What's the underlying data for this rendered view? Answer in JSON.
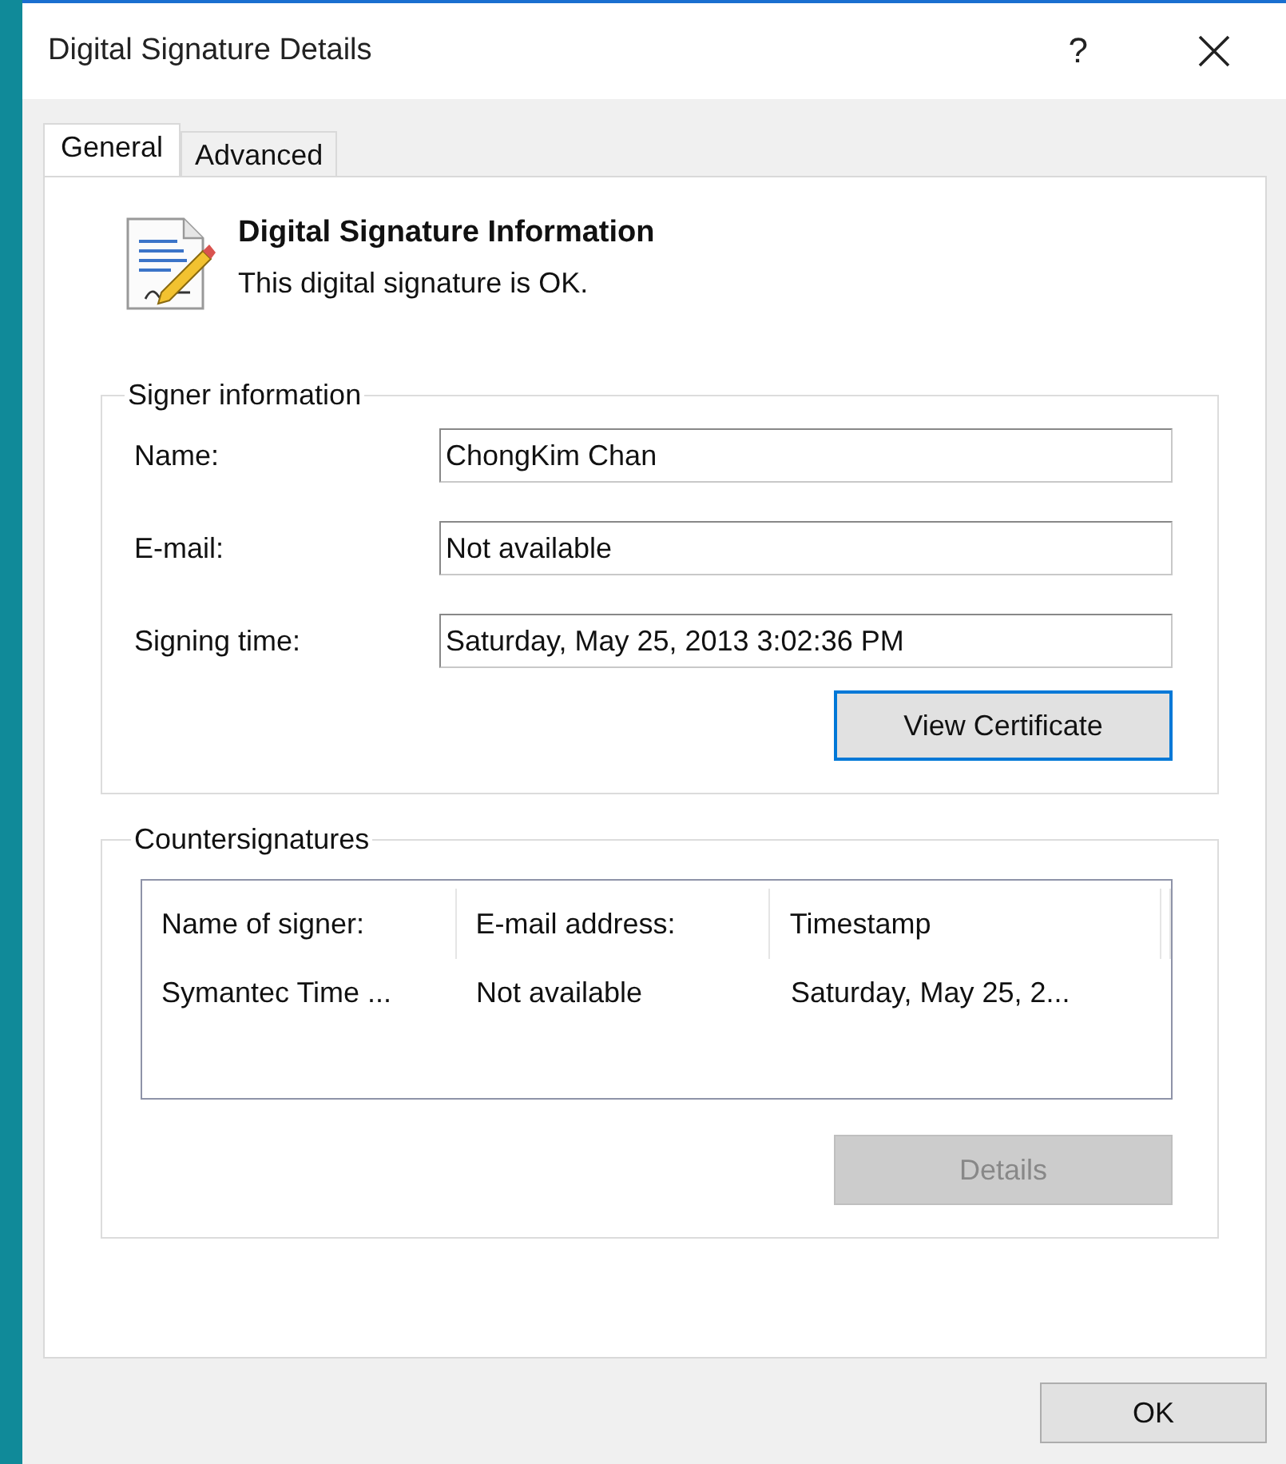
{
  "window": {
    "title": "Digital Signature Details",
    "help": "?"
  },
  "tabs": [
    {
      "label": "General",
      "selected": true
    },
    {
      "label": "Advanced",
      "selected": false
    }
  ],
  "header": {
    "title": "Digital Signature Information",
    "status": "This digital signature is OK."
  },
  "signer_information": {
    "legend": "Signer information",
    "fields": [
      {
        "label": "Name:",
        "value": "ChongKim Chan"
      },
      {
        "label": "E-mail:",
        "value": "Not available"
      },
      {
        "label": "Signing time:",
        "value": "Saturday, May 25, 2013 3:02:36 PM"
      }
    ],
    "button": {
      "label": "View Certificate",
      "disabled": false,
      "focused": true
    }
  },
  "countersignatures": {
    "legend": "Countersignatures",
    "columns": [
      "Name of signer:",
      "E-mail address:",
      "Timestamp"
    ],
    "rows": [
      {
        "cells": [
          "Symantec Time ...",
          "Not available",
          "Saturday, May 25, 2..."
        ]
      }
    ],
    "button": {
      "label": "Details",
      "disabled": true,
      "focused": false
    }
  },
  "buttons": [
    {
      "label": "OK"
    }
  ]
}
